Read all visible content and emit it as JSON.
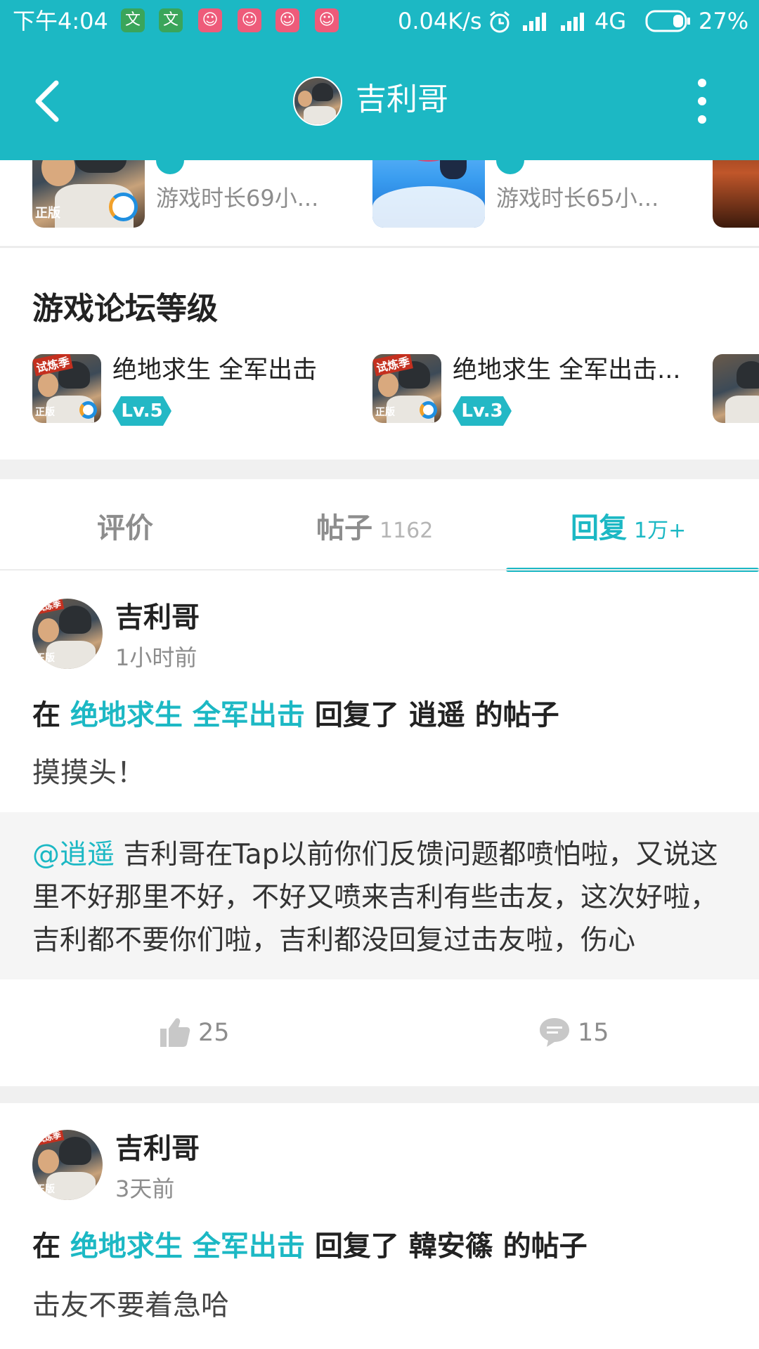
{
  "status_bar": {
    "time": "下午4:04",
    "notifications": [
      "文",
      "文"
    ],
    "network_speed": "0.04K/s",
    "network_type": "4G",
    "battery": "27%"
  },
  "app_bar": {
    "title": "吉利哥"
  },
  "played_games": [
    {
      "time": "游戏时长69小..."
    },
    {
      "time": "游戏时长65小..."
    }
  ],
  "forum_levels": {
    "title": "游戏论坛等级",
    "items": [
      {
        "name": "绝地求生 全军出击",
        "level": "Lv.5"
      },
      {
        "name": "绝地求生 全军出击...",
        "level": "Lv.3"
      }
    ]
  },
  "tabs": [
    {
      "label": "评价",
      "count": ""
    },
    {
      "label": "帖子",
      "count": "1162"
    },
    {
      "label": "回复",
      "count": "1万+",
      "active": true
    }
  ],
  "posts": [
    {
      "author": "吉利哥",
      "time": "1小时前",
      "prefix": "在",
      "game": "绝地求生 全军出击",
      "action": "回复了 逍遥 的帖子",
      "reply": "摸摸头！",
      "quote_mention": "@逍遥",
      "quote": "吉利哥在Tap以前你们反馈问题都喷怕啦，又说这里不好那里不好，不好又喷来吉利有些击友，这次好啦，吉利都不要你们啦，吉利都没回复过击友啦，伤心",
      "likes": "25",
      "comments": "15"
    },
    {
      "author": "吉利哥",
      "time": "3天前",
      "prefix": "在",
      "game": "绝地求生 全军出击",
      "action": "回复了 韓安篠 的帖子",
      "reply": "击友不要着急哈"
    }
  ],
  "colors": {
    "accent": "#1cb8c4",
    "level_badge": "#23b8c5",
    "band_gray": "#f0f0f0"
  }
}
